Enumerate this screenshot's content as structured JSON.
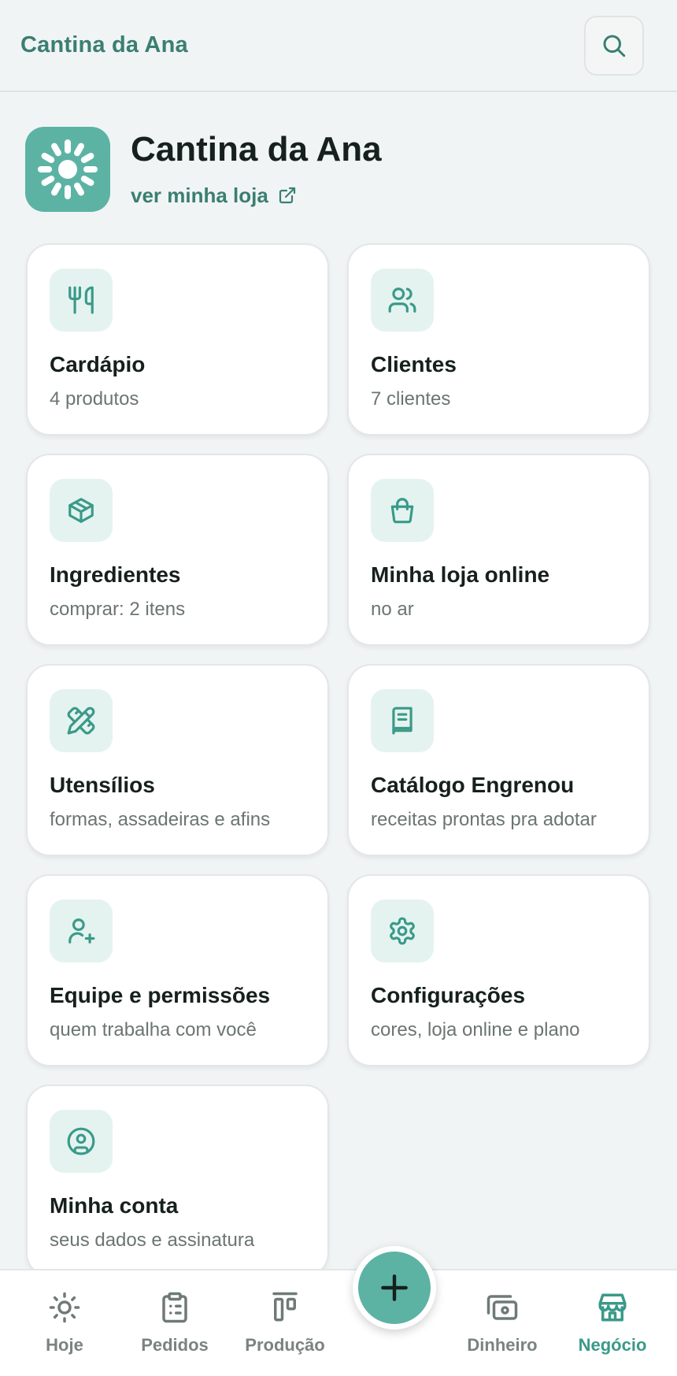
{
  "topbar": {
    "title": "Cantina da Ana"
  },
  "store": {
    "name": "Cantina da Ana",
    "link_label": "ver minha loja"
  },
  "cards": [
    {
      "title": "Cardápio",
      "subtitle": "4 produtos",
      "icon": "utensils-icon"
    },
    {
      "title": "Clientes",
      "subtitle": "7 clientes",
      "icon": "users-icon"
    },
    {
      "title": "Ingredientes",
      "subtitle": "comprar: 2 itens",
      "icon": "box-icon"
    },
    {
      "title": "Minha loja online",
      "subtitle": "no ar",
      "icon": "shopping-bag-icon"
    },
    {
      "title": "Utensílios",
      "subtitle": "formas, assadeiras e afins",
      "icon": "pencil-ruler-icon"
    },
    {
      "title": "Catálogo Engrenou",
      "subtitle": "receitas prontas pra adotar",
      "icon": "book-icon"
    },
    {
      "title": "Equipe e permissões",
      "subtitle": "quem trabalha com você",
      "icon": "user-plus-icon"
    },
    {
      "title": "Configurações",
      "subtitle": "cores, loja online e plano",
      "icon": "gear-icon"
    },
    {
      "title": "Minha conta",
      "subtitle": "seus dados e assinatura",
      "icon": "user-circle-icon"
    }
  ],
  "nav": {
    "items": [
      {
        "label": "Hoje",
        "icon": "sun-icon"
      },
      {
        "label": "Pedidos",
        "icon": "clipboard-icon"
      },
      {
        "label": "Produção",
        "icon": "production-icon"
      },
      {
        "label": "Dinheiro",
        "icon": "money-icon"
      },
      {
        "label": "Negócio",
        "icon": "store-icon"
      }
    ],
    "active": "Negócio",
    "fab_icon": "plus-icon"
  },
  "colors": {
    "accent": "#5cb3a4",
    "accent_dark": "#3a7f72",
    "icon_bg": "#e4f3f0",
    "background": "#f1f4f5"
  }
}
